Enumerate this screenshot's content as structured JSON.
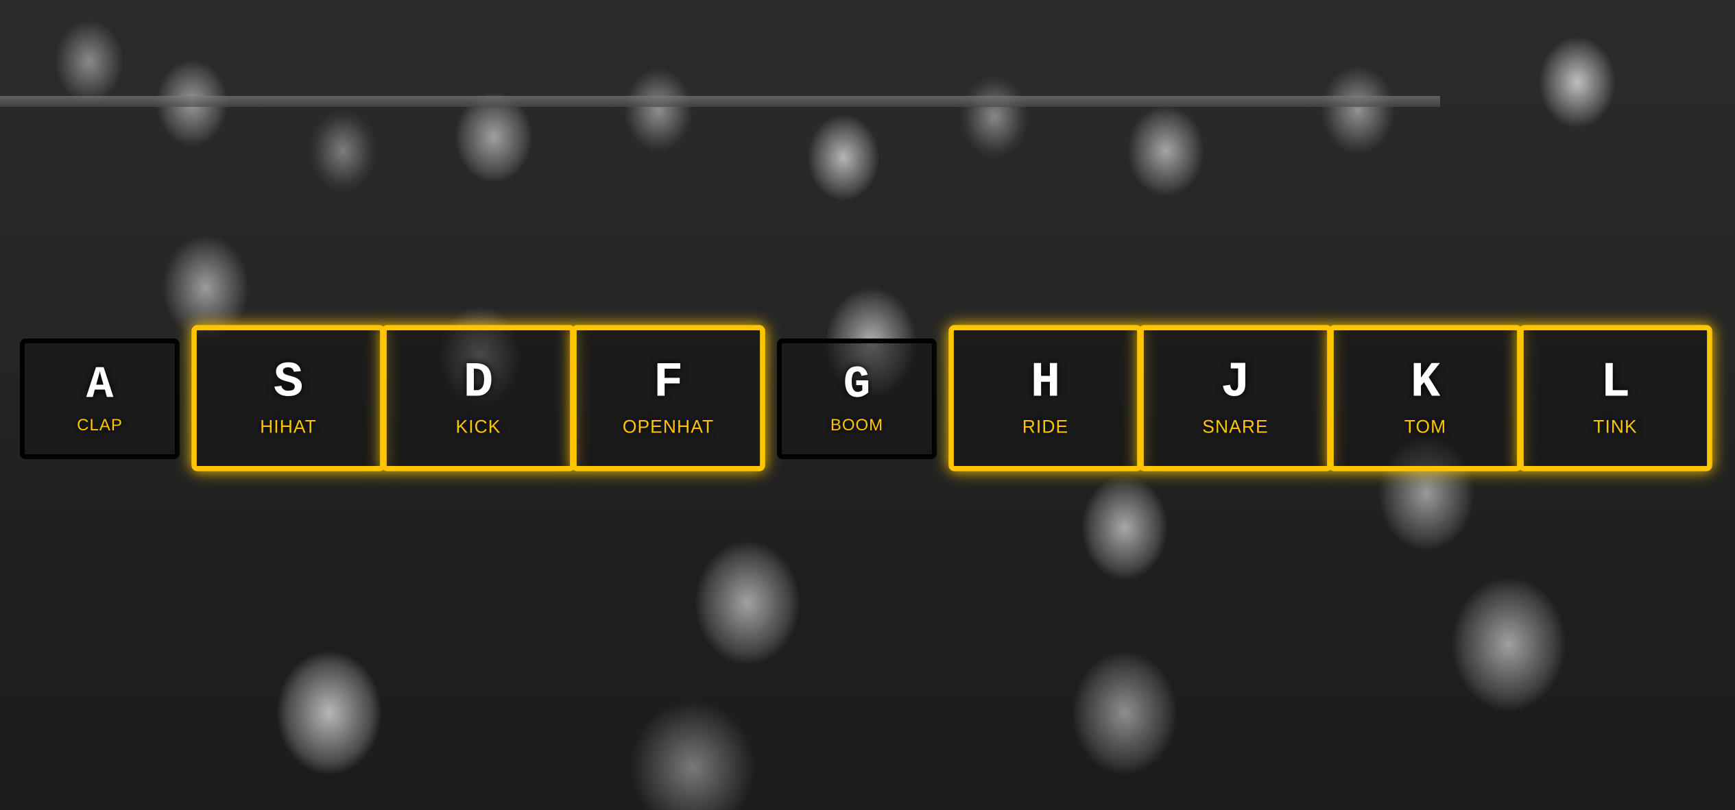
{
  "theme": {
    "accent": "#ffc600",
    "key_text": "#ffffff",
    "inactive_border": "#000000"
  },
  "keys": [
    {
      "key": "A",
      "sound": "clap",
      "playing": false
    },
    {
      "key": "S",
      "sound": "hihat",
      "playing": true
    },
    {
      "key": "D",
      "sound": "kick",
      "playing": true
    },
    {
      "key": "F",
      "sound": "openhat",
      "playing": true
    },
    {
      "key": "G",
      "sound": "boom",
      "playing": false
    },
    {
      "key": "H",
      "sound": "ride",
      "playing": true
    },
    {
      "key": "J",
      "sound": "snare",
      "playing": true
    },
    {
      "key": "K",
      "sound": "tom",
      "playing": true
    },
    {
      "key": "L",
      "sound": "tink",
      "playing": true
    }
  ]
}
